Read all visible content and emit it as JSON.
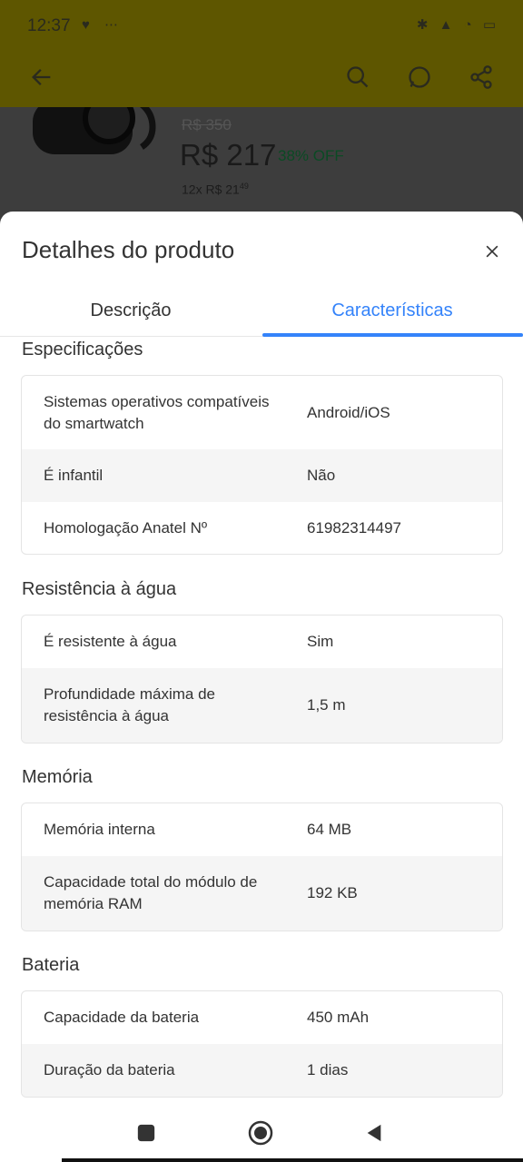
{
  "status_bar": {
    "time": "12:37",
    "battery": "39"
  },
  "product": {
    "old_price": "R$ 350",
    "price": "R$ 217",
    "discount": "38% OFF",
    "installments": "12x R$ 21",
    "installments_cents": "49"
  },
  "sheet": {
    "title": "Detalhes do produto",
    "tabs": [
      {
        "label": "Descrição",
        "active": false
      },
      {
        "label": "Características",
        "active": true
      }
    ]
  },
  "sections": [
    {
      "title": "Especificações",
      "rows": [
        {
          "label": "Sistemas operativos compatíveis do smartwatch",
          "value": "Android/iOS"
        },
        {
          "label": "É infantil",
          "value": "Não"
        },
        {
          "label": "Homologação Anatel Nº",
          "value": "61982314497"
        }
      ]
    },
    {
      "title": "Resistência à água",
      "rows": [
        {
          "label": "É resistente à água",
          "value": "Sim"
        },
        {
          "label": "Profundidade máxima de resistência à água",
          "value": "1,5 m"
        }
      ]
    },
    {
      "title": "Memória",
      "rows": [
        {
          "label": "Memória interna",
          "value": "64 MB"
        },
        {
          "label": "Capacidade total do módulo de memória RAM",
          "value": "192 KB"
        }
      ]
    },
    {
      "title": "Bateria",
      "rows": [
        {
          "label": "Capacidade da bateria",
          "value": "450 mAh"
        },
        {
          "label": "Duração da bateria",
          "value": "1 dias"
        }
      ]
    }
  ],
  "colors": {
    "accent": "#3483fa",
    "appbar": "#fff159"
  }
}
